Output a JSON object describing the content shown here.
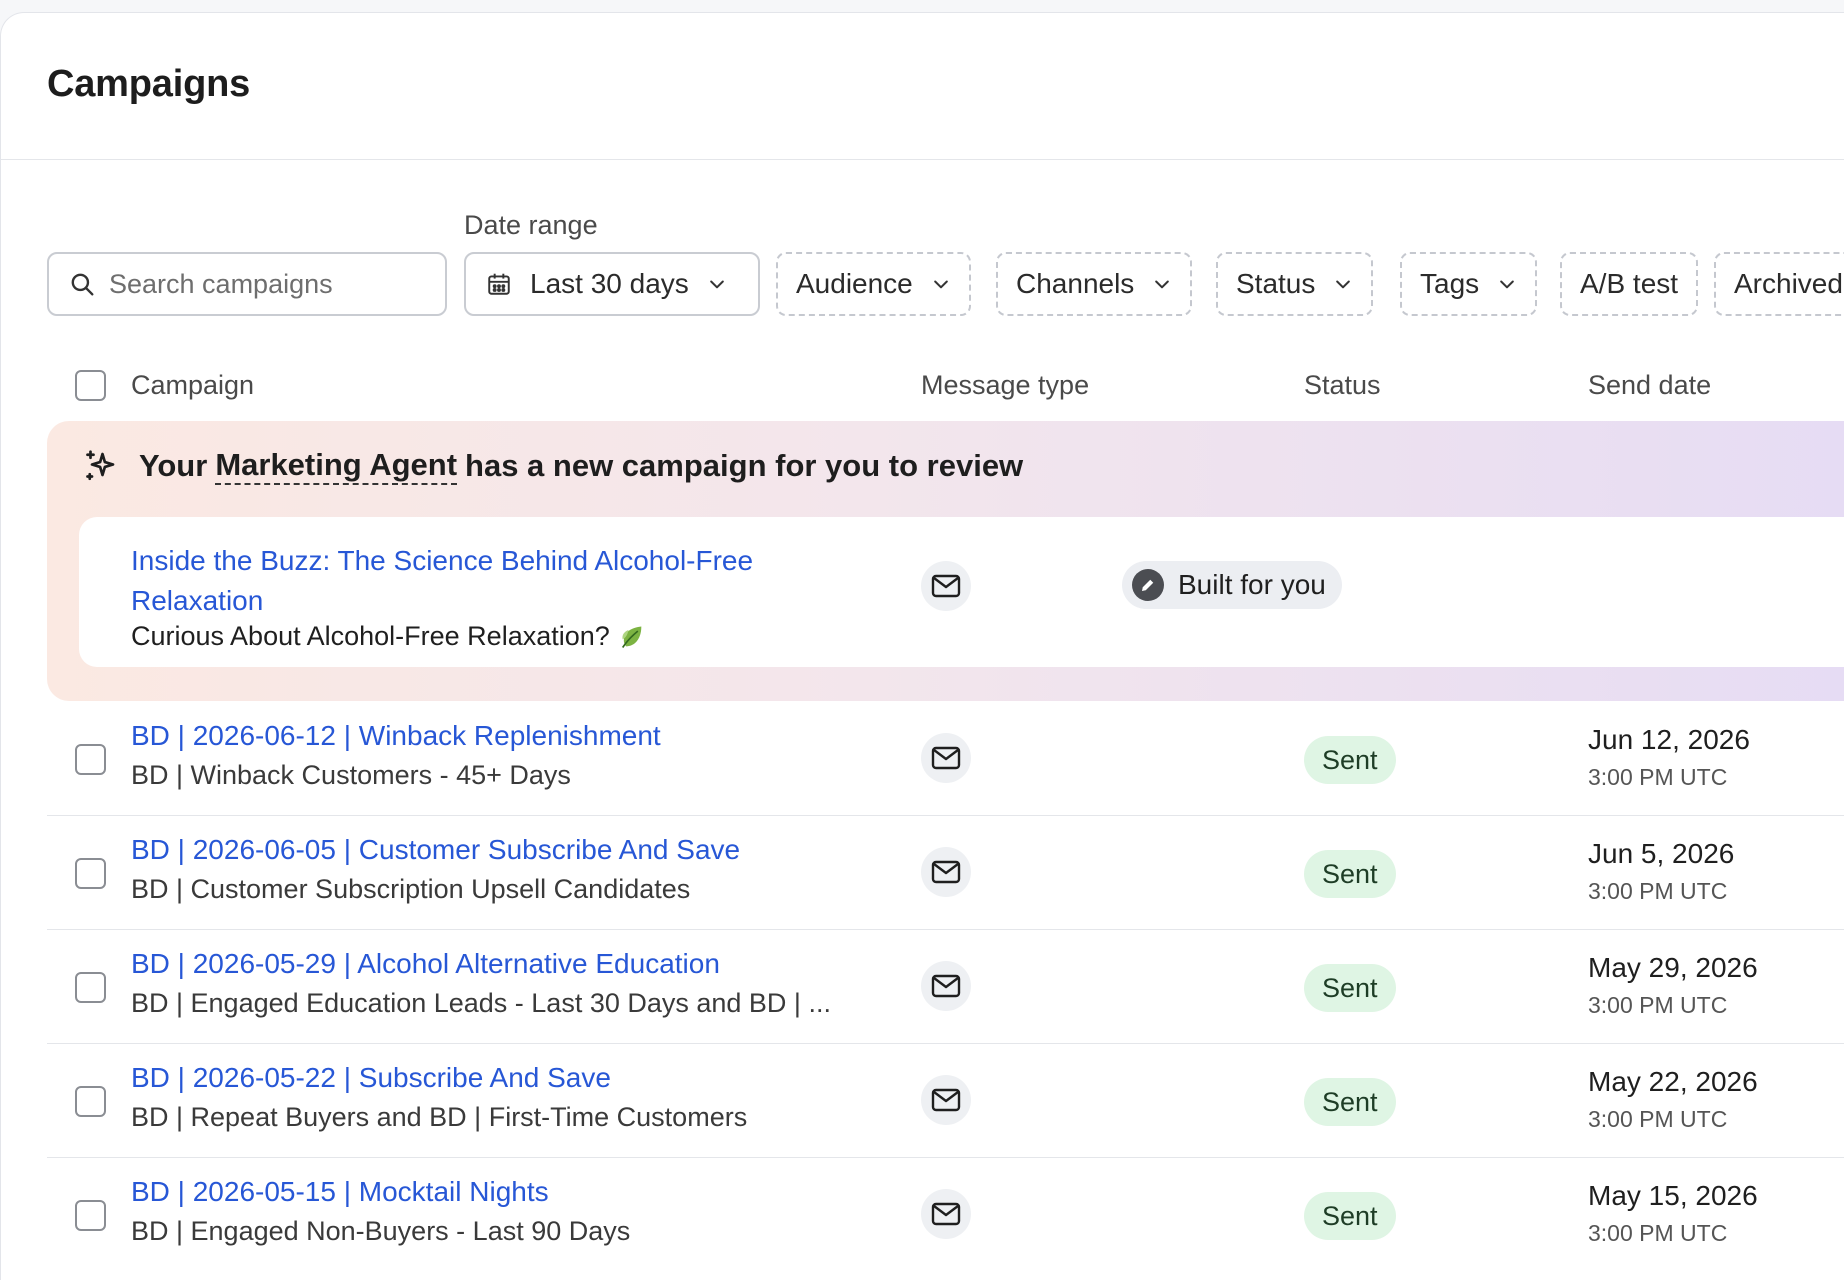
{
  "page": {
    "title": "Campaigns"
  },
  "filters": {
    "search_placeholder": "Search campaigns",
    "date_range_label": "Date range",
    "date_range_value": "Last 30 days",
    "chips": [
      "Audience",
      "Channels",
      "Status",
      "Tags",
      "A/B test",
      "Archived"
    ]
  },
  "table": {
    "columns": [
      "Campaign",
      "Message type",
      "Status",
      "Send date"
    ]
  },
  "agent": {
    "prefix": "Your",
    "agent_name": "Marketing Agent",
    "suffix": "has a new campaign for you to review",
    "campaign": {
      "title": "Inside the Buzz: The Science Behind Alcohol-Free Relaxation",
      "subject": "Curious About Alcohol-Free Relaxation?",
      "message_type_icon": "mail-icon",
      "status": "Built for you"
    }
  },
  "rows": [
    {
      "title": "BD | 2026-06-12 | Winback Replenishment",
      "audience": "BD | Winback Customers - 45+ Days",
      "status": "Sent",
      "date": "Jun 12, 2026",
      "time": "3:00 PM UTC"
    },
    {
      "title": "BD | 2026-06-05 | Customer Subscribe And Save",
      "audience": "BD | Customer Subscription Upsell Candidates",
      "status": "Sent",
      "date": "Jun 5, 2026",
      "time": "3:00 PM UTC"
    },
    {
      "title": "BD | 2026-05-29 | Alcohol Alternative Education",
      "audience": "BD | Engaged Education Leads - Last 30 Days and BD | ...",
      "status": "Sent",
      "date": "May 29, 2026",
      "time": "3:00 PM UTC"
    },
    {
      "title": "BD | 2026-05-22 | Subscribe And Save",
      "audience": "BD | Repeat Buyers and BD | First-Time Customers",
      "status": "Sent",
      "date": "May 22, 2026",
      "time": "3:00 PM UTC"
    },
    {
      "title": "BD | 2026-05-15 | Mocktail Nights",
      "audience": "BD | Engaged Non-Buyers - Last 90 Days",
      "status": "Sent",
      "date": "May 15, 2026",
      "time": "3:00 PM UTC"
    }
  ],
  "colors": {
    "link": "#2757d6",
    "sent_bg": "#dff5e4",
    "banner_start": "#fbe9e2",
    "banner_end": "#e6dcf4"
  }
}
